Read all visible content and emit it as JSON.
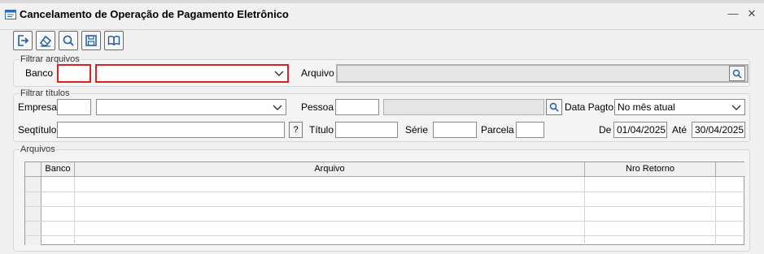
{
  "window": {
    "title": "Cancelamento de Operação de Pagamento Eletrônico",
    "minimize": "—",
    "close": "✕"
  },
  "toolbar": {
    "exit": "exit-icon",
    "clear": "eraser-icon",
    "search": "search-icon",
    "save": "save-icon",
    "help": "book-icon"
  },
  "filtrar_arquivos": {
    "legend": "Filtrar arquivos",
    "banco_label": "Banco",
    "banco_value": "",
    "banco_select": "",
    "arquivo_label": "Arquivo",
    "arquivo_value": ""
  },
  "filtrar_titulos": {
    "legend": "Filtrar títulos",
    "empresa_label": "Empresa",
    "empresa_value": "",
    "empresa_select": "",
    "pessoa_label": "Pessoa",
    "pessoa_code": "",
    "pessoa_name": "",
    "data_pagto_label": "Data Pagto.",
    "data_pagto_value": "No mês atual",
    "seqtitulo_label": "Seqtítulo",
    "seqtitulo_value": "",
    "help_btn": "?",
    "titulo_label": "Título",
    "titulo_value": "",
    "serie_label": "Série",
    "serie_value": "",
    "parcela_label": "Parcela",
    "parcela_value": "",
    "de_label": "De",
    "de_value": "01/04/2025",
    "ate_label": "Até",
    "ate_value": "30/04/2025"
  },
  "arquivos": {
    "legend": "Arquivos",
    "columns": [
      "Banco",
      "Arquivo",
      "Nro Retorno"
    ],
    "rows": []
  },
  "colors": {
    "highlight": "#e02020",
    "background": "#f0f0f0"
  }
}
